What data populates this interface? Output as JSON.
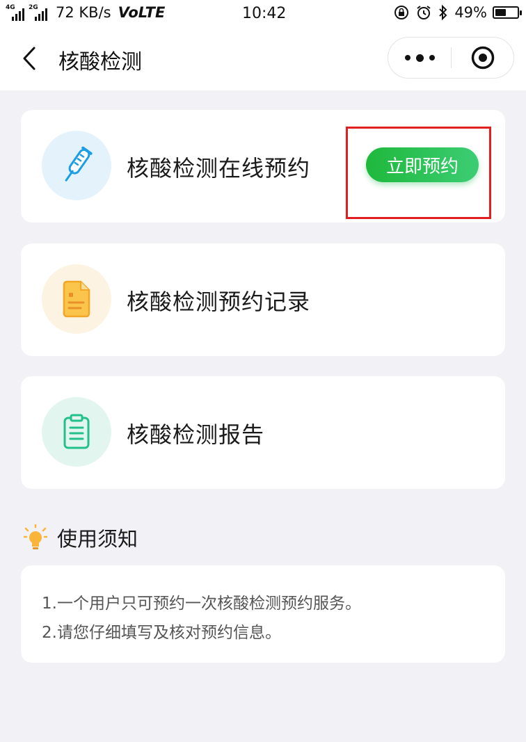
{
  "status_bar": {
    "signal1_tag": "4G",
    "signal2_tag": "2G",
    "speed": "72 KB/s",
    "network": "VoLTE",
    "time": "10:42",
    "battery_percent": "49%",
    "battery_level": 0.49
  },
  "nav": {
    "title": "核酸检测",
    "back_icon": "back-chevron-icon",
    "more_icon": "more-dots-icon",
    "close_icon": "target-close-icon"
  },
  "cards": [
    {
      "label": "核酸检测在线预约",
      "icon": "thermometer-icon",
      "icon_bg": "#e3f2fb",
      "button_label": "立即预约"
    },
    {
      "label": "核酸检测预约记录",
      "icon": "document-icon",
      "icon_bg": "#fdf3e2"
    },
    {
      "label": "核酸检测报告",
      "icon": "clipboard-icon",
      "icon_bg": "#e2f6ef"
    }
  ],
  "notice": {
    "title": "使用须知",
    "icon": "lightbulb-icon",
    "lines": [
      "1.一个用户只可预约一次核酸检测预约服务。",
      "2.请您仔细填写及核对预约信息。"
    ]
  },
  "colors": {
    "accent_green": "#22bb44",
    "highlight_red": "#e02020",
    "page_bg": "#f2f2f6"
  }
}
